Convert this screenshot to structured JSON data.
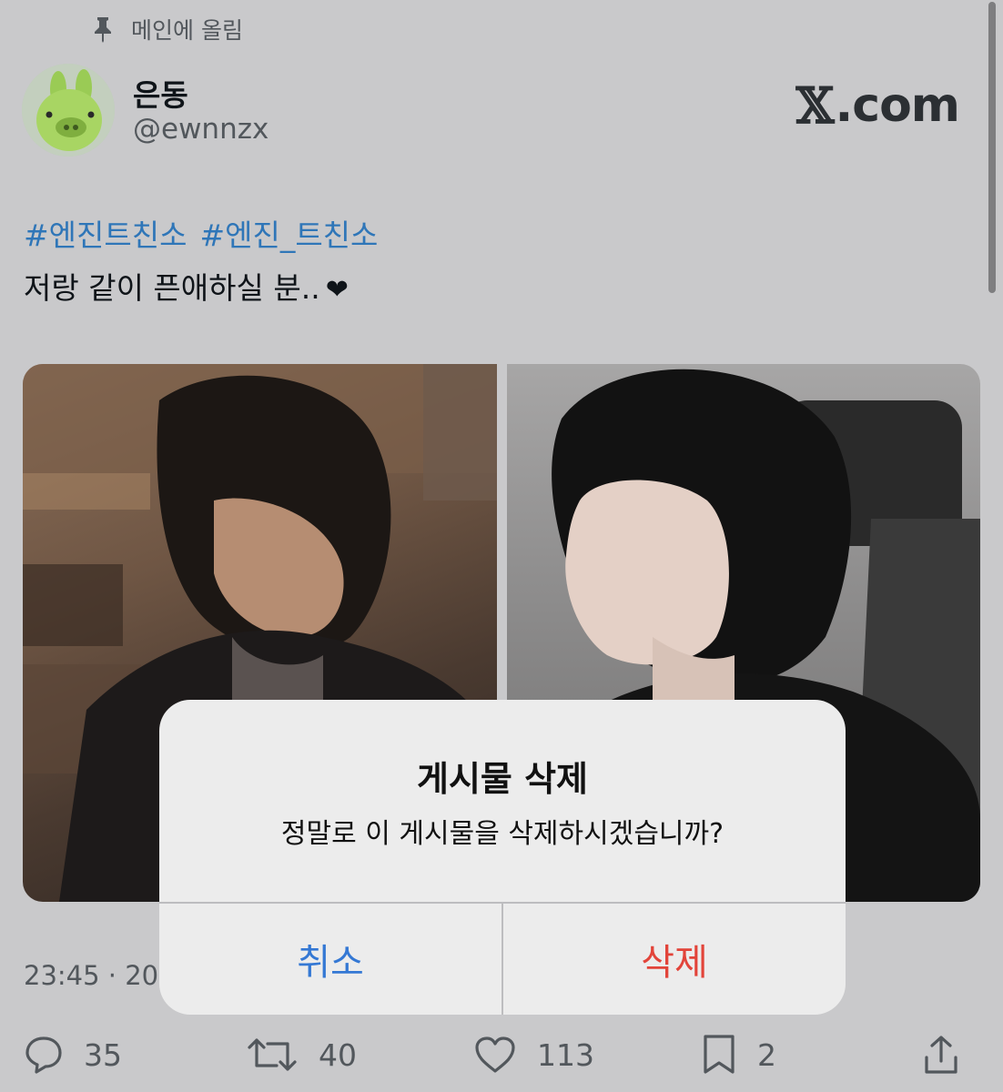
{
  "pinned": {
    "label": "메인에 올림",
    "icon": "pin-icon"
  },
  "author": {
    "display_name": "은동",
    "handle": "@ewnnzx",
    "avatar_icon": "avatar"
  },
  "brand": {
    "mark": "𝕏",
    "text": ".com"
  },
  "tweet": {
    "hashtags": [
      "#엔진트친소",
      "#엔진_트친소"
    ],
    "text": "저랑 같이 픈애하실 분..",
    "emoji": "❤"
  },
  "timestamp": "23:45 · 20",
  "actions": {
    "replies": "35",
    "retweets": "40",
    "likes": "113",
    "bookmarks": "2",
    "icons": [
      "reply-icon",
      "retweet-icon",
      "like-icon",
      "bookmark-icon",
      "share-icon"
    ]
  },
  "alert": {
    "title": "게시물 삭제",
    "message": "정말로 이 게시물을 삭제하시겠습니까?",
    "cancel_label": "취소",
    "delete_label": "삭제"
  },
  "colors": {
    "background": "#c9c9cb",
    "link": "#2f76b8",
    "cancel": "#3478d4",
    "destructive": "#e2443a",
    "secondary_text": "#52575c"
  }
}
